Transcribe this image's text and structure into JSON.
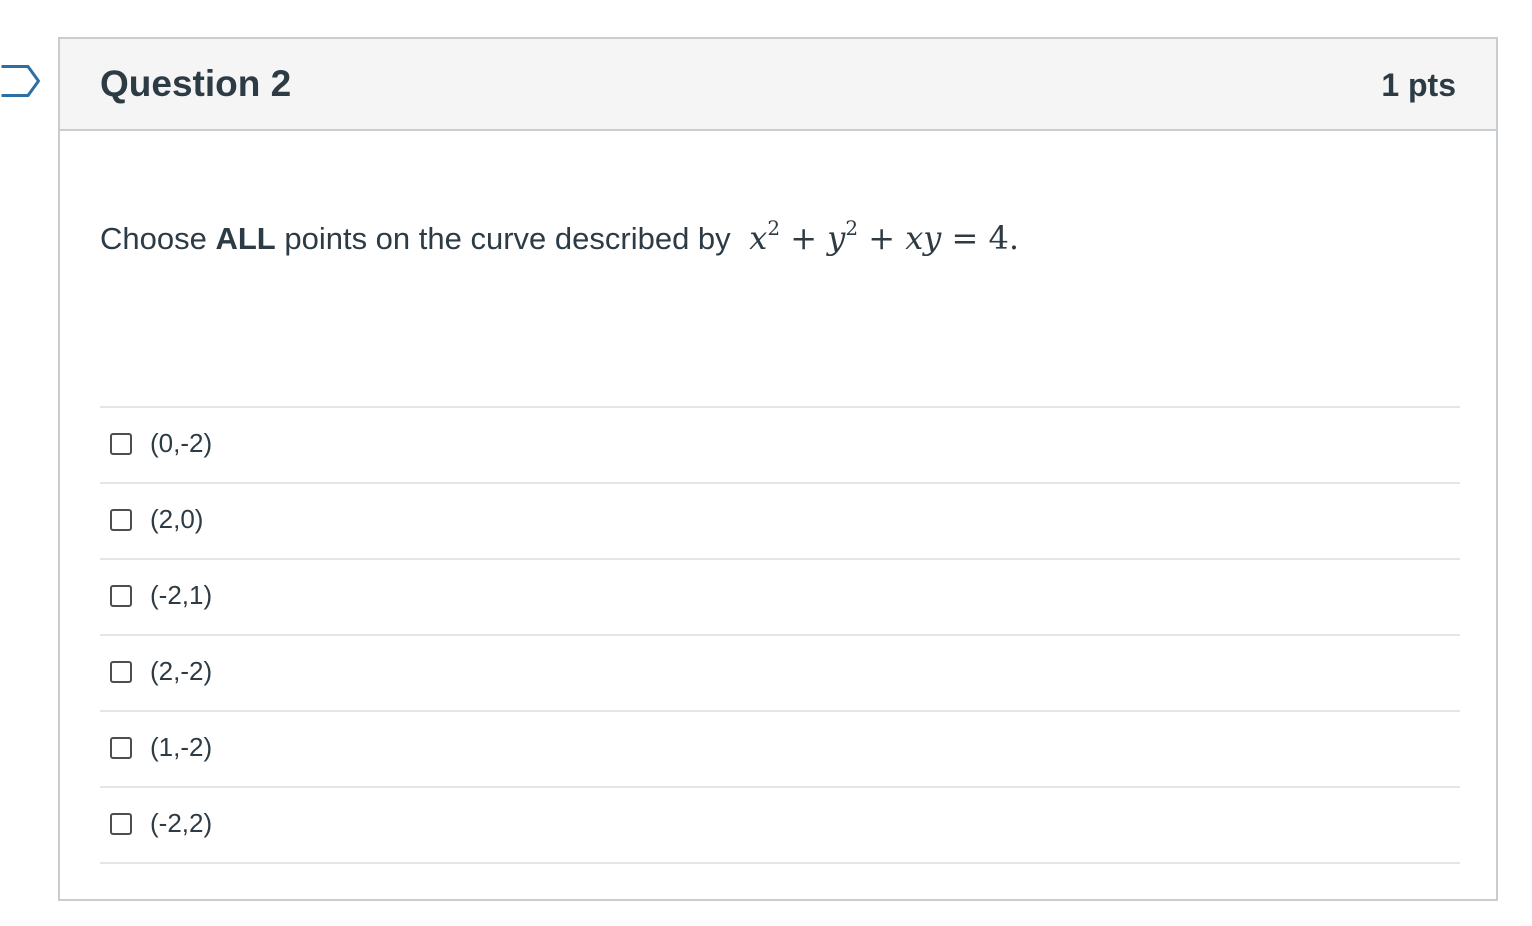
{
  "question": {
    "title": "Question 2",
    "points": "1 pts",
    "text_before": "Choose ",
    "text_bold": "ALL",
    "text_after": " points on the curve described by",
    "equation": "x² + y² + xy = 4."
  },
  "answers": [
    {
      "label": "(0,-2)",
      "checked": false
    },
    {
      "label": "(2,0)",
      "checked": false
    },
    {
      "label": "(-2,1)",
      "checked": false
    },
    {
      "label": "(2,-2)",
      "checked": false
    },
    {
      "label": "(1,-2)",
      "checked": false
    },
    {
      "label": "(-2,2)",
      "checked": false
    }
  ],
  "colors": {
    "text": "#2d3b45",
    "header_bg": "#f5f5f5",
    "border": "#c7cdd1",
    "divider": "#e3e5e7",
    "flag_outline": "#2d6ea5"
  },
  "icons": {
    "flag": "flag-question-icon",
    "checkbox": "checkbox-icon"
  }
}
